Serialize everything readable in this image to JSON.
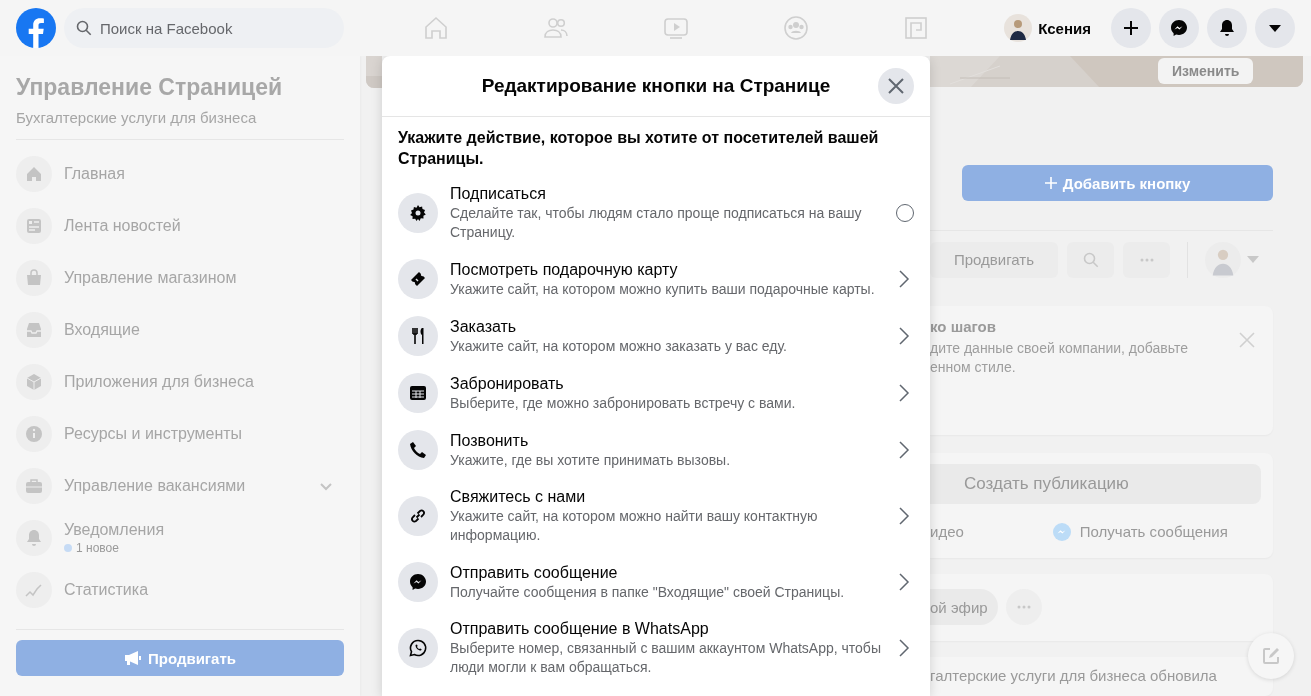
{
  "topbar": {
    "search": {
      "placeholder": "Поиск на Facebook"
    },
    "user": "Ксения"
  },
  "sidebar": {
    "title": "Управление Страницей",
    "subtitle": "Бухгалтерские услуги для бизнеса",
    "items": [
      {
        "label": "Главная"
      },
      {
        "label": "Лента новостей"
      },
      {
        "label": "Управление магазином"
      },
      {
        "label": "Входящие"
      },
      {
        "label": "Приложения для бизнеса"
      },
      {
        "label": "Ресурсы и инструменты"
      },
      {
        "label": "Управление вакансиями",
        "expanded": false
      },
      {
        "label": "Уведомления",
        "note": "1 новое",
        "color": "#c6dbf5"
      },
      {
        "label": "Статистика"
      }
    ],
    "promote_button": "Продвигать"
  },
  "page": {
    "edit_cover": "Изменить",
    "add_button": "Добавить кнопку",
    "promote": "Продвигать",
    "steps_card": {
      "title": "ко шагов",
      "text_1": "дите данные своей компании, добавьте",
      "text_2": "енном стиле."
    },
    "composer": {
      "placeholder": "Создать публикацию",
      "action_1": "идео",
      "action_2": "Получать сообщения"
    },
    "live": "ой эфир",
    "post_line": "галтерские услуги для бизнеса обновила"
  },
  "dialog": {
    "title": "Редактирование кнопки на Странице",
    "intro": "Укажите действие, которое вы хотите от посетителей вашей Страницы.",
    "options": [
      {
        "kind": "radio",
        "selected": false,
        "title": "Подписаться",
        "description": "Сделайте так, чтобы людям стало проще подписаться на вашу Страницу."
      },
      {
        "kind": "link",
        "title": "Посмотреть подарочную карту",
        "description": "Укажите сайт, на котором можно купить ваши подарочные карты."
      },
      {
        "kind": "link",
        "title": "Заказать",
        "description": "Укажите сайт, на котором можно заказать у вас еду."
      },
      {
        "kind": "link",
        "title": "Забронировать",
        "description": "Выберите, где можно забронировать встречу с вами."
      },
      {
        "kind": "link",
        "title": "Позвонить",
        "description": "Укажите, где вы хотите принимать вызовы."
      },
      {
        "kind": "link",
        "title": "Свяжитесь с нами",
        "description": "Укажите сайт, на котором можно найти вашу контактную информацию."
      },
      {
        "kind": "link",
        "title": "Отправить сообщение",
        "description": "Получайте сообщения в папке \"Входящие\" своей Страницы."
      },
      {
        "kind": "link",
        "title": "Отправить сообщение в WhatsApp",
        "description": "Выберите номер, связанный с вашим аккаунтом WhatsApp, чтобы люди могли к вам обращаться."
      }
    ]
  }
}
